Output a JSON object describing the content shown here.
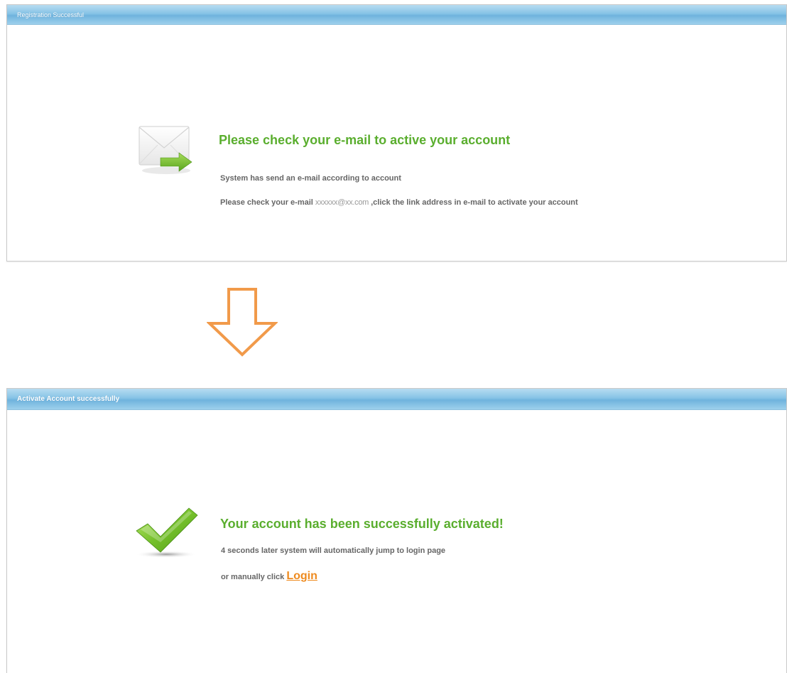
{
  "panel_registration": {
    "header": "Registration Successful",
    "title": "Please check your e-mail to active your account",
    "line1": "System has send an e-mail according to account",
    "line2_prefix": "Please check your e-mail",
    "email": "xxxxxx@xx.com",
    "line2_suffix": ",click the link address in e-mail to activate your account"
  },
  "panel_activation": {
    "header": "Activate Account successfully",
    "title": "Your account has been successfully activated!",
    "line1": "4 seconds later system will automatically jump to login page",
    "line2_prefix": "or manually click",
    "login_link": "Login"
  },
  "icons": {
    "mail": "envelope-arrow-icon",
    "check": "checkmark-icon",
    "arrow": "down-arrow-icon"
  },
  "colors": {
    "headline": "#5aae2e",
    "body": "#666666",
    "link": "#ee8a1e",
    "arrow": "#f19a4a",
    "header": "#86c3e6"
  }
}
